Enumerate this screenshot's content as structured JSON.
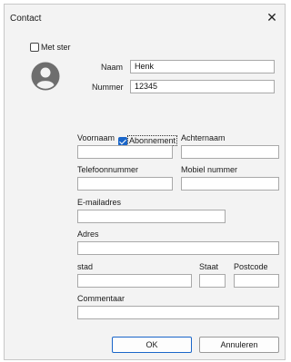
{
  "window": {
    "title": "Contact",
    "close_icon": "close-icon"
  },
  "favorite": {
    "label": "Met ster",
    "checked": false
  },
  "avatar": {
    "icon": "person-avatar-icon"
  },
  "fields": {
    "naam": {
      "label": "Naam",
      "value": "Henk"
    },
    "nummer": {
      "label": "Nummer",
      "value": "12345"
    },
    "abonnement": {
      "label": "Abonnement",
      "checked": true
    },
    "voornaam": {
      "label": "Voornaam",
      "value": ""
    },
    "achternaam": {
      "label": "Achternaam",
      "value": ""
    },
    "telefoonnummer": {
      "label": "Telefoonnummer",
      "value": ""
    },
    "mobiel": {
      "label": "Mobiel nummer",
      "value": ""
    },
    "email": {
      "label": "E-mailadres",
      "value": ""
    },
    "adres": {
      "label": "Adres",
      "value": ""
    },
    "stad": {
      "label": "stad",
      "value": ""
    },
    "staat": {
      "label": "Staat",
      "value": ""
    },
    "postcode": {
      "label": "Postcode",
      "value": ""
    },
    "commentaar": {
      "label": "Commentaar",
      "value": ""
    }
  },
  "buttons": {
    "ok": "OK",
    "cancel": "Annuleren"
  },
  "colors": {
    "accent": "#1a66c9",
    "window_bg": "#f3f3f3"
  }
}
